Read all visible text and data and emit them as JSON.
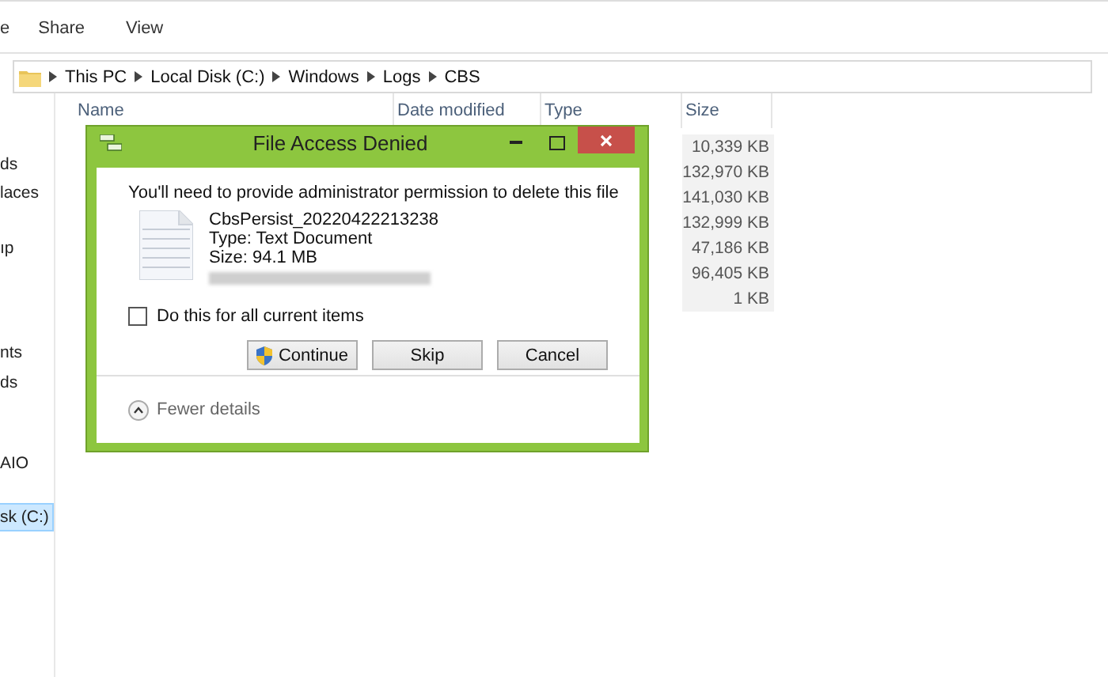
{
  "ribbon": {
    "tabs": [
      {
        "label": "e"
      },
      {
        "label": "Share"
      },
      {
        "label": "View"
      }
    ]
  },
  "address_bar": {
    "crumbs": [
      "This PC",
      "Local Disk (C:)",
      "Windows",
      "Logs",
      "CBS"
    ]
  },
  "nav_pane": {
    "items": [
      {
        "label": "ds",
        "selected": false
      },
      {
        "label": "laces",
        "selected": false
      },
      {
        "label": "ıp",
        "selected": false
      },
      {
        "label": "nts",
        "selected": false
      },
      {
        "label": "ds",
        "selected": false
      },
      {
        "label": "AIO",
        "selected": false
      },
      {
        "label": "sk (C:)",
        "selected": true
      }
    ]
  },
  "file_list": {
    "columns": [
      "Name",
      "Date modified",
      "Type",
      "Size"
    ],
    "sizes": [
      "10,339 KB",
      "132,970 KB",
      "141,030 KB",
      "132,999 KB",
      "47,186 KB",
      "96,405 KB",
      "1 KB"
    ]
  },
  "dialog": {
    "title": "File Access Denied",
    "message": "You'll need to provide administrator permission to delete this file",
    "file_name": "CbsPersist_20220422213238",
    "file_type": "Type: Text Document",
    "file_size": "Size: 94.1 MB",
    "checkbox": {
      "label": "Do this for all current items",
      "checked": false
    },
    "buttons": [
      {
        "label": "Continue",
        "kind": "shield"
      },
      {
        "label": "Skip",
        "kind": "plain"
      },
      {
        "label": "Cancel",
        "kind": "plain"
      }
    ],
    "details_toggle": {
      "label": "Fewer details",
      "expanded": true
    }
  }
}
